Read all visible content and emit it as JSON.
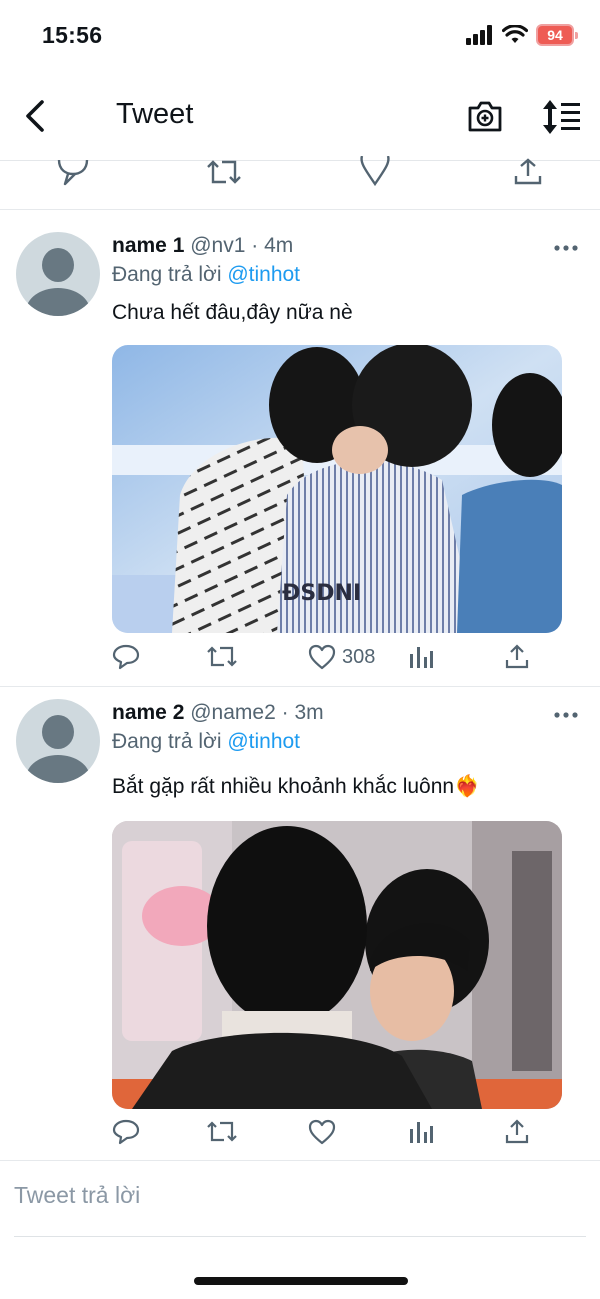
{
  "status_bar": {
    "time": "15:56",
    "battery": "94",
    "icons": [
      "signal-icon",
      "wifi-icon",
      "battery-icon"
    ]
  },
  "nav": {
    "title": "Tweet",
    "icons": [
      "back-arrow-icon",
      "camera-plus-icon",
      "sort-icon"
    ]
  },
  "tweets": [
    {
      "name": "name 1",
      "handle": "@nv1",
      "time": "4m",
      "reply_prefix": "Đang trả lời",
      "reply_to": "@tinhot",
      "text": "Chưa hết đâu,đây nữa nè",
      "likes": "308"
    },
    {
      "name": "name 2",
      "handle": "@name2",
      "time": "3m",
      "reply_prefix": "Đang trả lời",
      "reply_to": "@tinhot",
      "text": "Bắt gặp rất nhiều khoảnh khắc luônn❤️‍🔥",
      "likes": ""
    }
  ],
  "composer": {
    "placeholder": "Tweet trả lời"
  },
  "colors": {
    "accent": "#1d9bf0",
    "secondary_text": "#536471",
    "battery": "#ee5c55"
  }
}
